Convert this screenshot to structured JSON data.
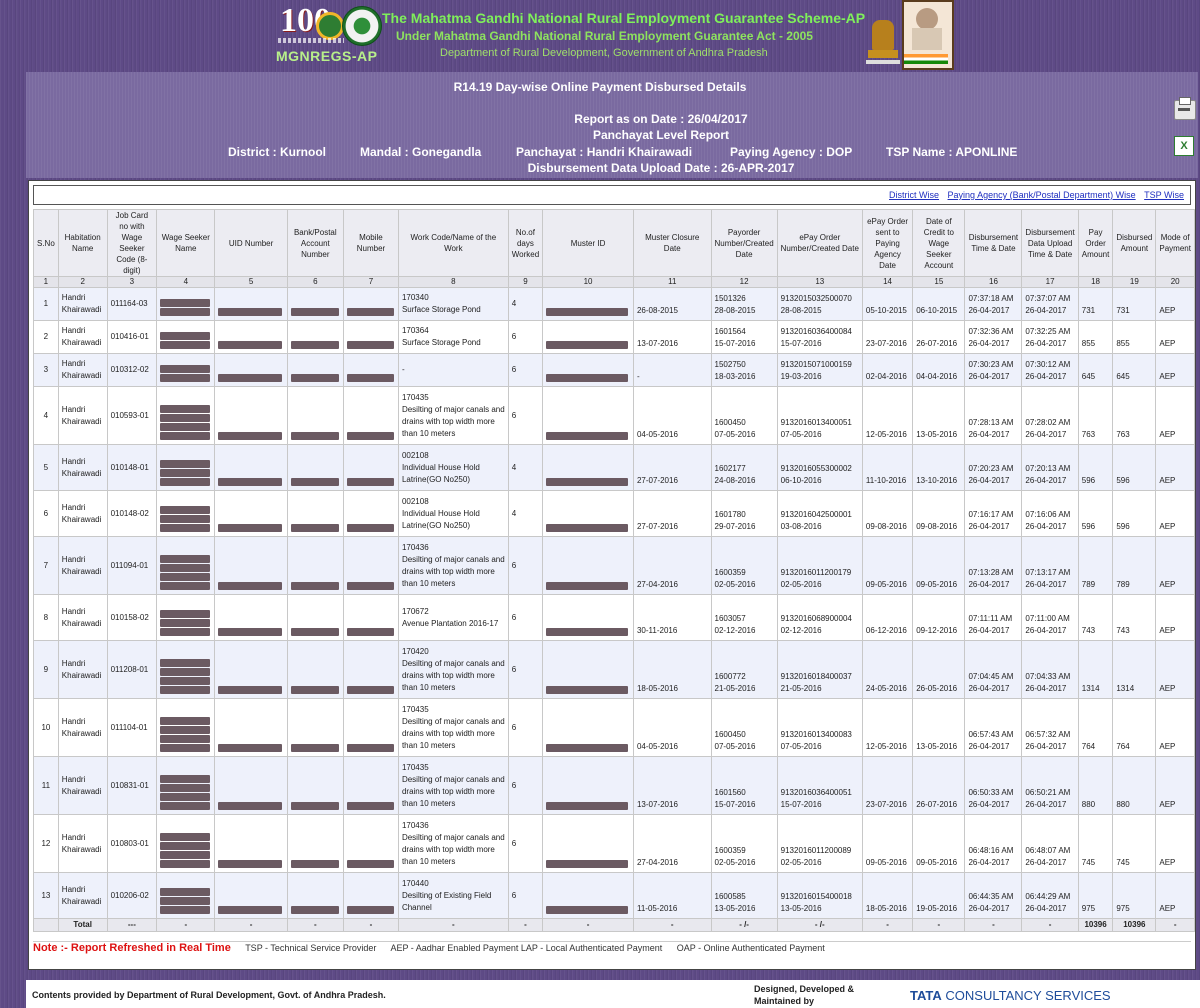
{
  "header": {
    "logo_text": "100",
    "brand": "MGNREGS-AP",
    "title1": "The Mahatma Gandhi National Rural Employment Guarantee Scheme-AP",
    "title2": "Under Mahatma Gandhi National Rural Employment Guarantee Act - 2005",
    "title3": "Department of Rural Development, Government of Andhra Pradesh"
  },
  "report": {
    "title": "R14.19 Day-wise Online Payment Disbursed Details",
    "as_on": "Report as on Date : 26/04/2017",
    "level": "Panchayat Level Report",
    "district": "District : Kurnool",
    "mandal": "Mandal : Gonegandla",
    "panchayat": "Panchayat : Handri Khairawadi",
    "agency": "Paying Agency : DOP",
    "tsp": "TSP Name : APONLINE",
    "upload": "Disbursement Data Upload Date : 26-APR-2017"
  },
  "links": [
    "District Wise",
    "Paying Agency (Bank/Postal Department) Wise",
    "TSP Wise"
  ],
  "columns": [
    "S.No",
    "Habitation Name",
    "Job Card no with Wage Seeker Code (8-digit)",
    "Wage Seeker Name",
    "UID Number",
    "Bank/Postal Account Number",
    "Mobile Number",
    "Work Code/Name of the Work",
    "No.of days Worked",
    "Muster ID",
    "Muster Closure Date",
    "Payorder Number/Created Date",
    "ePay Order Number/Created Date",
    "ePay Order sent to Paying Agency Date",
    "Date of Credit to Wage Seeker Account",
    "Disbursement Time & Date",
    "Disbursement Data Upload Time & Date",
    "Pay Order Amount",
    "Disbursed Amount",
    "Mode of Payment"
  ],
  "column_numbers": [
    "1",
    "2",
    "3",
    "4",
    "5",
    "6",
    "7",
    "8",
    "9",
    "10",
    "11",
    "12",
    "13",
    "14",
    "15",
    "16",
    "17",
    "18",
    "19",
    "20"
  ],
  "rows": [
    {
      "sno": "1",
      "hab": "Handri Khairawadi",
      "job": "011164-03",
      "work_code": "170340",
      "work_name": "Surface Storage Pond",
      "days": "4",
      "muster_close": "26-08-2015",
      "payorder": "1501326",
      "payorder_date": "28-08-2015",
      "epay": "9132015032500070",
      "epay_date": "28-08-2015",
      "sent": "05-10-2015",
      "credit": "06-10-2015",
      "disb_time": "07:37:18 AM",
      "disb_date": "26-04-2017",
      "up_time": "07:37:07 AM",
      "up_date": "26-04-2017",
      "pay_amt": "731",
      "disb_amt": "731",
      "mode": "AEP"
    },
    {
      "sno": "2",
      "hab": "Handri Khairawadi",
      "job": "010416-01",
      "work_code": "170364",
      "work_name": "Surface Storage Pond",
      "days": "6",
      "muster_close": "13-07-2016",
      "payorder": "1601564",
      "payorder_date": "15-07-2016",
      "epay": "9132016036400084",
      "epay_date": "15-07-2016",
      "sent": "23-07-2016",
      "credit": "26-07-2016",
      "disb_time": "07:32:36 AM",
      "disb_date": "26-04-2017",
      "up_time": "07:32:25 AM",
      "up_date": "26-04-2017",
      "pay_amt": "855",
      "disb_amt": "855",
      "mode": "AEP"
    },
    {
      "sno": "3",
      "hab": "Handri Khairawadi",
      "job": "010312-02",
      "work_code": "",
      "work_name": "-",
      "days": "6",
      "muster_close": "-",
      "payorder": "1502750",
      "payorder_date": "18-03-2016",
      "epay": "9132015071000159",
      "epay_date": "19-03-2016",
      "sent": "02-04-2016",
      "credit": "04-04-2016",
      "disb_time": "07:30:23 AM",
      "disb_date": "26-04-2017",
      "up_time": "07:30:12 AM",
      "up_date": "26-04-2017",
      "pay_amt": "645",
      "disb_amt": "645",
      "mode": "AEP"
    },
    {
      "sno": "4",
      "hab": "Handri Khairawadi",
      "job": "010593-01",
      "work_code": "170435",
      "work_name": "Desilting of major canals and drains with top width more than 10 meters",
      "days": "6",
      "muster_close": "04-05-2016",
      "payorder": "1600450",
      "payorder_date": "07-05-2016",
      "epay": "9132016013400051",
      "epay_date": "07-05-2016",
      "sent": "12-05-2016",
      "credit": "13-05-2016",
      "disb_time": "07:28:13 AM",
      "disb_date": "26-04-2017",
      "up_time": "07:28:02 AM",
      "up_date": "26-04-2017",
      "pay_amt": "763",
      "disb_amt": "763",
      "mode": "AEP"
    },
    {
      "sno": "5",
      "hab": "Handri Khairawadi",
      "job": "010148-01",
      "work_code": "002108",
      "work_name": "Individual House Hold Latrine(GO No250)",
      "days": "4",
      "muster_close": "27-07-2016",
      "payorder": "1602177",
      "payorder_date": "24-08-2016",
      "epay": "9132016055300002",
      "epay_date": "06-10-2016",
      "sent": "11-10-2016",
      "credit": "13-10-2016",
      "disb_time": "07:20:23 AM",
      "disb_date": "26-04-2017",
      "up_time": "07:20:13 AM",
      "up_date": "26-04-2017",
      "pay_amt": "596",
      "disb_amt": "596",
      "mode": "AEP"
    },
    {
      "sno": "6",
      "hab": "Handri Khairawadi",
      "job": "010148-02",
      "work_code": "002108",
      "work_name": "Individual House Hold Latrine(GO No250)",
      "days": "4",
      "muster_close": "27-07-2016",
      "payorder": "1601780",
      "payorder_date": "29-07-2016",
      "epay": "9132016042500001",
      "epay_date": "03-08-2016",
      "sent": "09-08-2016",
      "credit": "09-08-2016",
      "disb_time": "07:16:17 AM",
      "disb_date": "26-04-2017",
      "up_time": "07:16:06 AM",
      "up_date": "26-04-2017",
      "pay_amt": "596",
      "disb_amt": "596",
      "mode": "AEP"
    },
    {
      "sno": "7",
      "hab": "Handri Khairawadi",
      "job": "011094-01",
      "work_code": "170436",
      "work_name": "Desilting of major canals and drains with top width more than 10 meters",
      "days": "6",
      "muster_close": "27-04-2016",
      "payorder": "1600359",
      "payorder_date": "02-05-2016",
      "epay": "9132016011200179",
      "epay_date": "02-05-2016",
      "sent": "09-05-2016",
      "credit": "09-05-2016",
      "disb_time": "07:13:28 AM",
      "disb_date": "26-04-2017",
      "up_time": "07:13:17 AM",
      "up_date": "26-04-2017",
      "pay_amt": "789",
      "disb_amt": "789",
      "mode": "AEP"
    },
    {
      "sno": "8",
      "hab": "Handri Khairawadi",
      "job": "010158-02",
      "work_code": "170672",
      "work_name": "Avenue Plantation 2016-17",
      "days": "6",
      "muster_close": "30-11-2016",
      "payorder": "1603057",
      "payorder_date": "02-12-2016",
      "epay": "9132016068900004",
      "epay_date": "02-12-2016",
      "sent": "06-12-2016",
      "credit": "09-12-2016",
      "disb_time": "07:11:11 AM",
      "disb_date": "26-04-2017",
      "up_time": "07:11:00 AM",
      "up_date": "26-04-2017",
      "pay_amt": "743",
      "disb_amt": "743",
      "mode": "AEP"
    },
    {
      "sno": "9",
      "hab": "Handri Khairawadi",
      "job": "011208-01",
      "work_code": "170420",
      "work_name": "Desilting of major canals and drains with top width more than 10 meters",
      "days": "6",
      "muster_close": "18-05-2016",
      "payorder": "1600772",
      "payorder_date": "21-05-2016",
      "epay": "9132016018400037",
      "epay_date": "21-05-2016",
      "sent": "24-05-2016",
      "credit": "26-05-2016",
      "disb_time": "07:04:45 AM",
      "disb_date": "26-04-2017",
      "up_time": "07:04:33 AM",
      "up_date": "26-04-2017",
      "pay_amt": "1314",
      "disb_amt": "1314",
      "mode": "AEP"
    },
    {
      "sno": "10",
      "hab": "Handri Khairawadi",
      "job": "011104-01",
      "work_code": "170435",
      "work_name": "Desilting of major canals and drains with top width more than 10 meters",
      "days": "6",
      "muster_close": "04-05-2016",
      "payorder": "1600450",
      "payorder_date": "07-05-2016",
      "epay": "9132016013400083",
      "epay_date": "07-05-2016",
      "sent": "12-05-2016",
      "credit": "13-05-2016",
      "disb_time": "06:57:43 AM",
      "disb_date": "26-04-2017",
      "up_time": "06:57:32 AM",
      "up_date": "26-04-2017",
      "pay_amt": "764",
      "disb_amt": "764",
      "mode": "AEP"
    },
    {
      "sno": "11",
      "hab": "Handri Khairawadi",
      "job": "010831-01",
      "work_code": "170435",
      "work_name": "Desilting of major canals and drains with top width more than 10 meters",
      "days": "6",
      "muster_close": "13-07-2016",
      "payorder": "1601560",
      "payorder_date": "15-07-2016",
      "epay": "9132016036400051",
      "epay_date": "15-07-2016",
      "sent": "23-07-2016",
      "credit": "26-07-2016",
      "disb_time": "06:50:33 AM",
      "disb_date": "26-04-2017",
      "up_time": "06:50:21 AM",
      "up_date": "26-04-2017",
      "pay_amt": "880",
      "disb_amt": "880",
      "mode": "AEP"
    },
    {
      "sno": "12",
      "hab": "Handri Khairawadi",
      "job": "010803-01",
      "work_code": "170436",
      "work_name": "Desilting of major canals and drains with top width more than 10 meters",
      "days": "6",
      "muster_close": "27-04-2016",
      "payorder": "1600359",
      "payorder_date": "02-05-2016",
      "epay": "9132016011200089",
      "epay_date": "02-05-2016",
      "sent": "09-05-2016",
      "credit": "09-05-2016",
      "disb_time": "06:48:16 AM",
      "disb_date": "26-04-2017",
      "up_time": "06:48:07 AM",
      "up_date": "26-04-2017",
      "pay_amt": "745",
      "disb_amt": "745",
      "mode": "AEP"
    },
    {
      "sno": "13",
      "hab": "Handri Khairawadi",
      "job": "010206-02",
      "work_code": "170440",
      "work_name": "Desilting of Existing Field Channel",
      "days": "6",
      "muster_close": "11-05-2016",
      "payorder": "1600585",
      "payorder_date": "13-05-2016",
      "epay": "9132016015400018",
      "epay_date": "13-05-2016",
      "sent": "18-05-2016",
      "credit": "19-05-2016",
      "disb_time": "06:44:35 AM",
      "disb_date": "26-04-2017",
      "up_time": "06:44:29 AM",
      "up_date": "26-04-2017",
      "pay_amt": "975",
      "disb_amt": "975",
      "mode": "AEP"
    }
  ],
  "total": {
    "label": "Total",
    "job": "---",
    "dash": "-",
    "payorder": "- /-",
    "epay": "- /-",
    "pay_amt": "10396",
    "disb_amt": "10396"
  },
  "note": {
    "label": "Note :- Report Refreshed in Real Time",
    "tsp": "TSP - Technical Service Provider",
    "aep": "AEP - Aadhar Enabled Payment LAP - Local Authenticated Payment",
    "oap": "OAP - Online Authenticated Payment"
  },
  "footer": {
    "left": "Contents provided by Department of Rural Development, Govt. of Andhra Pradesh.",
    "designed": "Designed, Developed & Maintained by",
    "tcs_bold": "TATA",
    "tcs": "CONSULTANCY SERVICES"
  },
  "icons": {
    "print": "printer-icon",
    "excel": "excel-icon"
  }
}
